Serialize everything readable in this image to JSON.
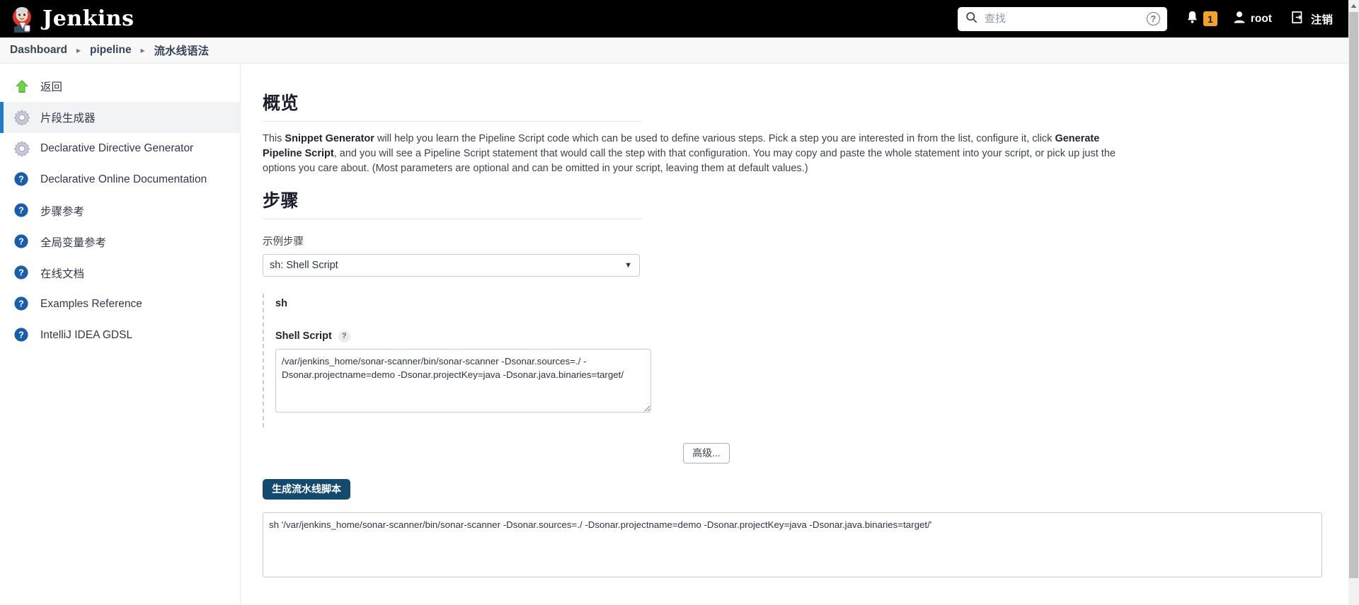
{
  "header": {
    "brand": "Jenkins",
    "brand_logo_icon": "jenkins-butler-logo",
    "search": {
      "placeholder": "查找",
      "value": "",
      "icon": "search-icon",
      "help_icon": "question-circle-icon"
    },
    "notifications": {
      "icon": "bell-icon",
      "count": "1",
      "badge_color": "#f0a22e"
    },
    "user": {
      "icon": "person-icon",
      "name": "root"
    },
    "logout": {
      "icon": "logout-icon",
      "label": "注销"
    }
  },
  "breadcrumb": {
    "items": [
      {
        "label": "Dashboard"
      },
      {
        "label": "pipeline"
      },
      {
        "label": "流水线语法"
      }
    ],
    "separator": "▸"
  },
  "sidebar": {
    "items": [
      {
        "label": "返回",
        "icon": "up-arrow-icon",
        "active": false
      },
      {
        "label": "片段生成器",
        "icon": "gear-icon",
        "active": true
      },
      {
        "label": "Declarative Directive Generator",
        "icon": "gear-icon",
        "active": false
      },
      {
        "label": "Declarative Online Documentation",
        "icon": "help-icon",
        "active": false
      },
      {
        "label": "步骤参考",
        "icon": "help-icon",
        "active": false
      },
      {
        "label": "全局变量参考",
        "icon": "help-icon",
        "active": false
      },
      {
        "label": "在线文档",
        "icon": "help-icon",
        "active": false
      },
      {
        "label": "Examples Reference",
        "icon": "help-icon",
        "active": false
      },
      {
        "label": "IntelliJ IDEA GDSL",
        "icon": "help-icon",
        "active": false
      }
    ]
  },
  "main": {
    "overview": {
      "title": "概览",
      "text_part1": "This ",
      "bold1": "Snippet Generator",
      "text_part2": " will help you learn the Pipeline Script code which can be used to define various steps. Pick a step you are interested in from the list, configure it, click ",
      "bold2": "Generate Pipeline Script",
      "text_part3": ", and you will see a Pipeline Script statement that would call the step with that configuration. You may copy and paste the whole statement into your script, or pick up just the options you care about. (Most parameters are optional and can be omitted in your script, leaving them at default values.)"
    },
    "steps": {
      "title": "步骤",
      "sample_step_label": "示例步骤",
      "selected_step": "sh: Shell Script",
      "chevron_icon": "chevron-down-icon",
      "step_block": {
        "step_name": "sh",
        "param_label": "Shell Script",
        "help_badge": "?",
        "script_value": "/var/jenkins_home/sonar-scanner/bin/sonar-scanner -Dsonar.sources=./ -Dsonar.projectname=demo -Dsonar.projectKey=java -Dsonar.java.binaries=target/"
      },
      "advanced_button": "高级...",
      "generate_button": "生成流水线脚本",
      "generated_output": "sh '/var/jenkins_home/sonar-scanner/bin/sonar-scanner -Dsonar.sources=./ -Dsonar.projectname=demo -Dsonar.projectKey=java -Dsonar.java.binaries=target/'"
    }
  },
  "scrollbar": {
    "up_arrow_icon": "scroll-up-arrow-icon"
  }
}
